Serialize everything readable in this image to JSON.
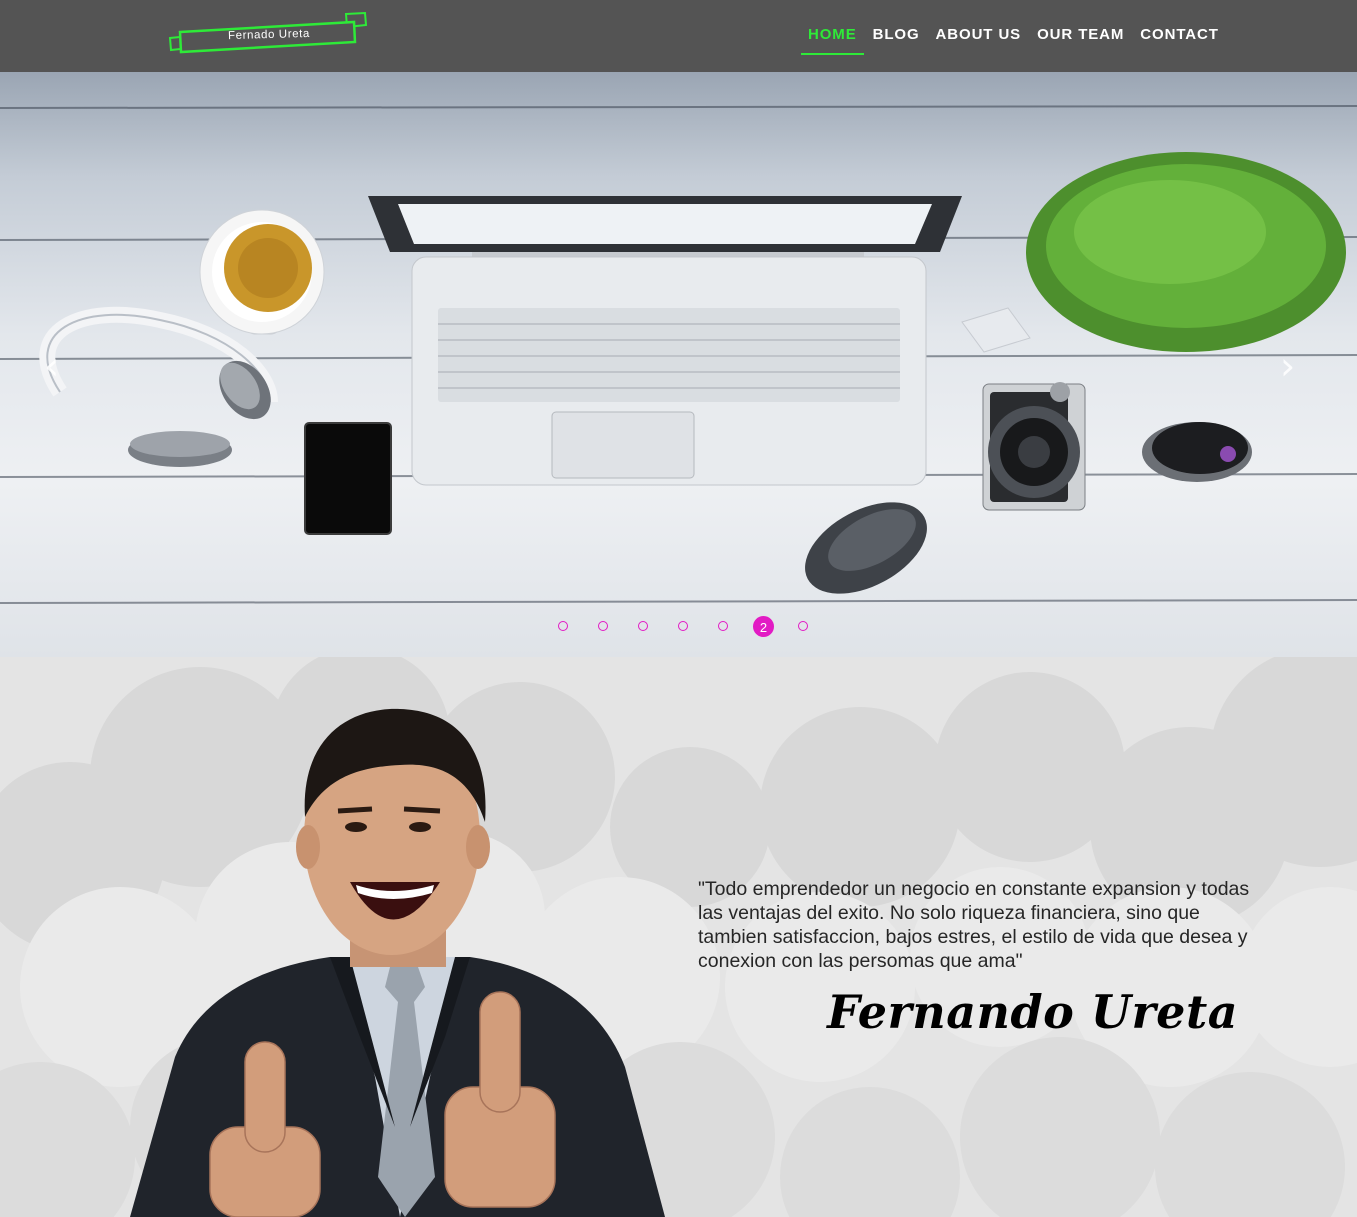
{
  "brand": {
    "logo_text": "Fernado Ureta"
  },
  "nav": {
    "items": [
      {
        "label": "HOME",
        "active": true
      },
      {
        "label": "BLOG",
        "active": false
      },
      {
        "label": "ABOUT US",
        "active": false
      },
      {
        "label": "OUR TEAM",
        "active": false
      },
      {
        "label": "CONTACT",
        "active": false
      }
    ]
  },
  "carousel": {
    "prev_icon": "chevron-left-icon",
    "next_icon": "chevron-right-icon",
    "indicator_count": 7,
    "active_index": 5,
    "active_label": "2"
  },
  "testimonial": {
    "quote": "\"Todo emprendedor un negocio en constante expansion y todas las ventajas del exito. No solo riqueza financiera, sino que tambien satisfaccion, bajos estres, el estilo de vida que desea y conexion con las persomas que ama\"",
    "author": "Fernando Ureta"
  },
  "colors": {
    "nav_bg": "#545454",
    "accent_green": "#2eea38",
    "indicator_magenta": "#e21bc4",
    "section_bg": "#e4e4e4"
  }
}
